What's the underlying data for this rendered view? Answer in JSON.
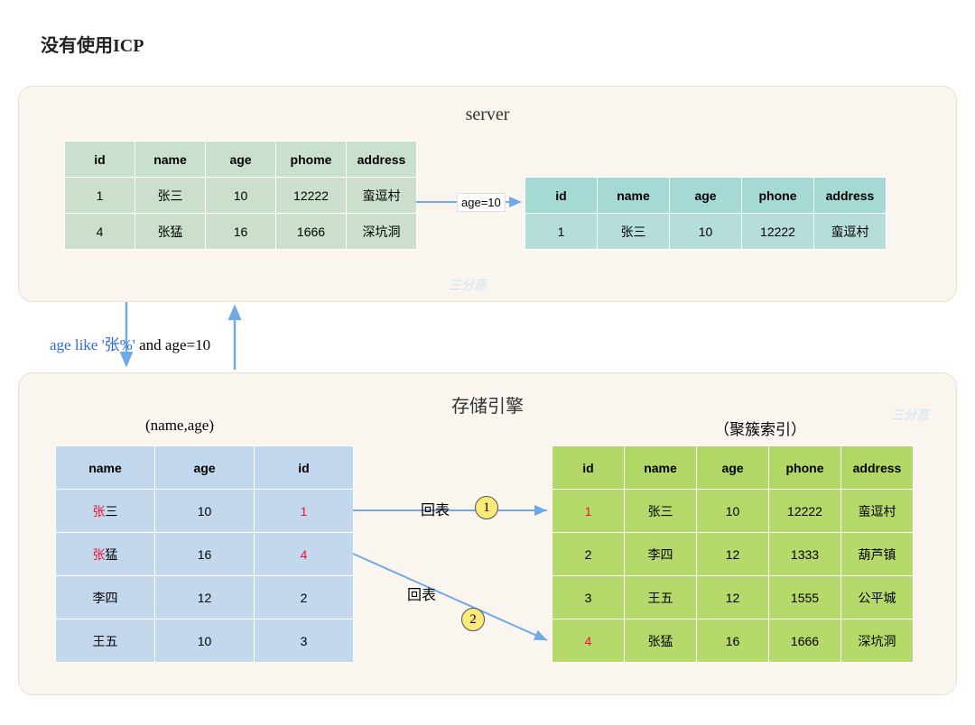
{
  "title": "没有使用ICP",
  "server": {
    "title": "server",
    "left_table": {
      "headers": [
        "id",
        "name",
        "age",
        "phome",
        "address"
      ],
      "rows": [
        [
          "1",
          "张三",
          "10",
          "12222",
          "蛮逗村"
        ],
        [
          "4",
          "张猛",
          "16",
          "1666",
          "深坑洞"
        ]
      ]
    },
    "right_table": {
      "headers": [
        "id",
        "name",
        "age",
        "phone",
        "address"
      ],
      "rows": [
        [
          "1",
          "张三",
          "10",
          "12222",
          "蛮逗村"
        ]
      ]
    },
    "filter_label": "age=10"
  },
  "between": {
    "down_label_part1": "age like '张%'",
    "down_label_and": " and age=10"
  },
  "storage": {
    "title": "存储引擎",
    "index_label": "(name,age)",
    "clustered_label": "（聚簇索引）",
    "index_table": {
      "headers": [
        "name",
        "age",
        "id"
      ],
      "rows": [
        {
          "name": "张三",
          "name_prefix_red": "张",
          "name_suffix": "三",
          "age": "10",
          "id": "1",
          "id_red": true
        },
        {
          "name": "张猛",
          "name_prefix_red": "张",
          "name_suffix": "猛",
          "age": "16",
          "id": "4",
          "id_red": true
        },
        {
          "name": "李四",
          "name_prefix_red": "",
          "name_suffix": "李四",
          "age": "12",
          "id": "2",
          "id_red": false
        },
        {
          "name": "王五",
          "name_prefix_red": "",
          "name_suffix": "王五",
          "age": "10",
          "id": "3",
          "id_red": false
        }
      ]
    },
    "clustered_table": {
      "headers": [
        "id",
        "name",
        "age",
        "phone",
        "address"
      ],
      "rows": [
        {
          "id": "1",
          "id_red": true,
          "name": "张三",
          "age": "10",
          "phone": "12222",
          "address": "蛮逗村"
        },
        {
          "id": "2",
          "id_red": false,
          "name": "李四",
          "age": "12",
          "phone": "1333",
          "address": "葫芦镇"
        },
        {
          "id": "3",
          "id_red": false,
          "name": "王五",
          "age": "12",
          "phone": "1555",
          "address": "公平城"
        },
        {
          "id": "4",
          "id_red": true,
          "name": "张猛",
          "age": "16",
          "phone": "1666",
          "address": "深坑洞"
        }
      ]
    },
    "lookup_label": "回表",
    "step1": "1",
    "step2": "2"
  },
  "signature": "三分恶"
}
